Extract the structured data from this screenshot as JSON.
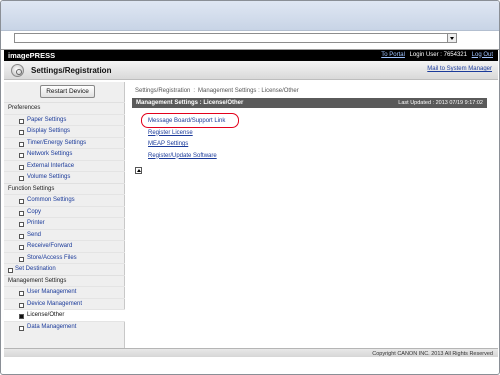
{
  "browser": {
    "address_value": ""
  },
  "header": {
    "brand": "imagePRESS",
    "to_portal": "To Portal",
    "login_user": "Login User : 7654321",
    "logout": "Log Out",
    "title": "Settings/Registration",
    "mail_link": "Mail to System Manager"
  },
  "sidebar": {
    "restart_label": "Restart Device",
    "sections": [
      {
        "heading": "Preferences",
        "items": [
          "Paper Settings",
          "Display Settings",
          "Timer/Energy Settings",
          "Network Settings",
          "External Interface",
          "Volume Settings"
        ]
      },
      {
        "heading": "Function Settings",
        "items": [
          "Common Settings",
          "Copy",
          "Printer",
          "Send",
          "Receive/Forward",
          "Store/Access Files"
        ]
      },
      {
        "top_item": "Set Destination"
      },
      {
        "heading": "Management Settings",
        "items": [
          "User Management",
          "Device Management",
          "License/Other",
          "Data Management"
        ],
        "selected": "License/Other"
      }
    ]
  },
  "main": {
    "breadcrumb": [
      "Settings/Registration",
      ":",
      "Management Settings : License/Other"
    ],
    "section_title": "Management Settings : License/Other",
    "last_updated": "Last Updated : 2013 07/19 9:17:02",
    "links": [
      "Message Board/Support Link",
      "Register License",
      "MEAP Settings",
      "Register/Update Software"
    ]
  },
  "footer": {
    "copyright": "Copyright CANON INC. 2013 All Rights Reserved"
  },
  "colors": {
    "link": "#1a3a9a",
    "highlight_ring": "#e3001b",
    "header_bar": "#000000",
    "section_bar": "#5a5a5a"
  }
}
